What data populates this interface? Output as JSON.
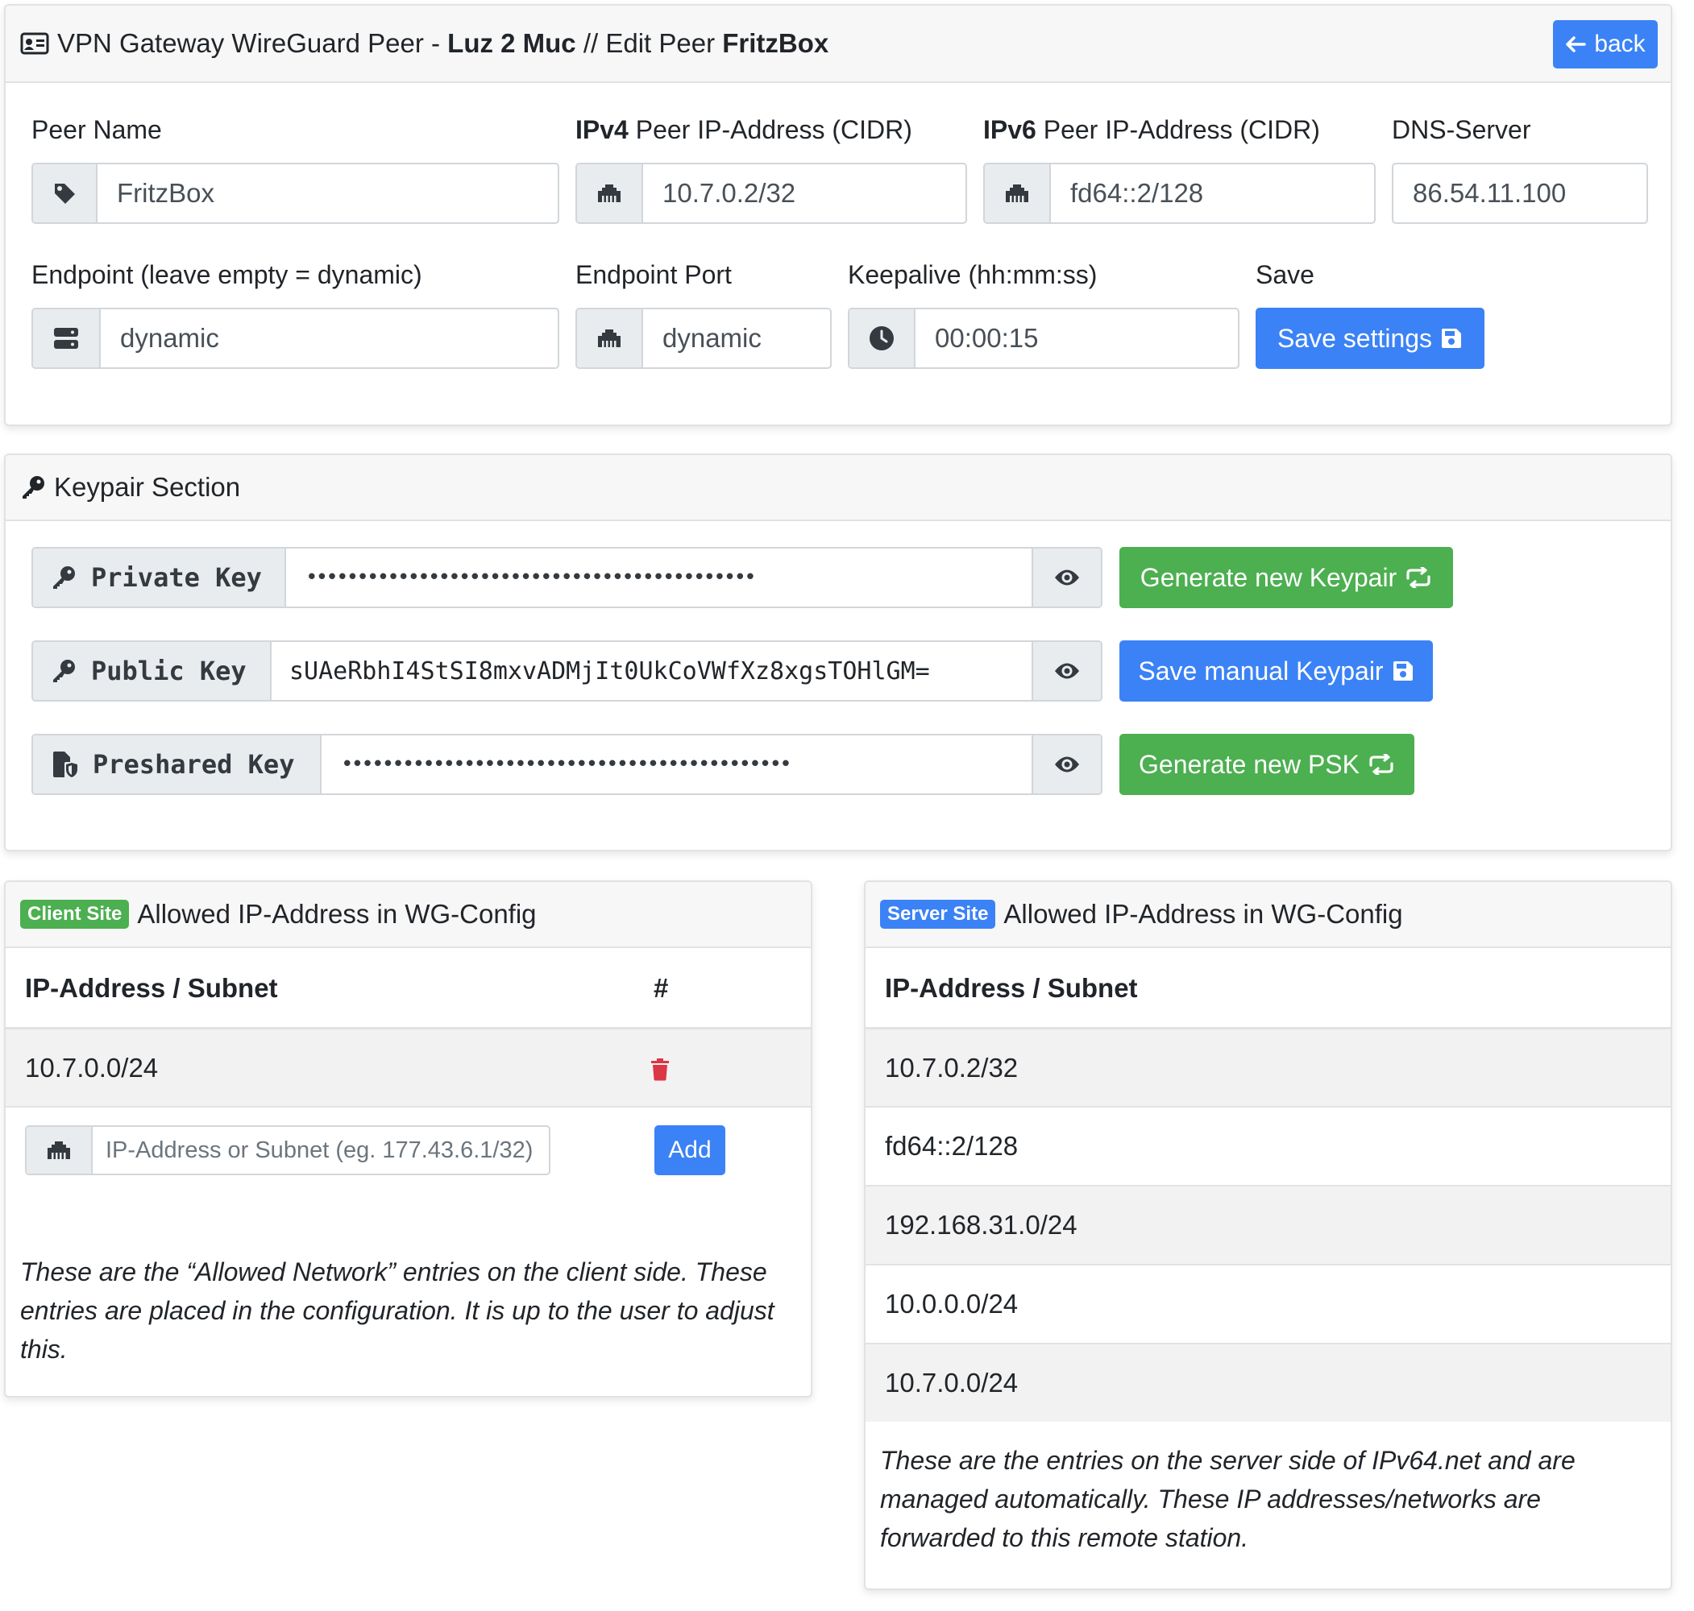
{
  "header": {
    "title_prefix": "VPN Gateway WireGuard Peer - ",
    "gateway_name": "Luz 2 Muc",
    "title_mid": " // Edit Peer ",
    "peer_name": "FritzBox",
    "back_label": "back"
  },
  "settings": {
    "peer_name_label": "Peer Name",
    "peer_name_value": "FritzBox",
    "ipv4_bold": "IPv4",
    "ipv4_label": " Peer IP-Address (CIDR)",
    "ipv4_value": "10.7.0.2/32",
    "ipv6_bold": "IPv6",
    "ipv6_label": " Peer IP-Address (CIDR)",
    "ipv6_value": "fd64::2/128",
    "dns_label": "DNS-Server",
    "dns_value": "86.54.11.100",
    "endpoint_label": "Endpoint (leave empty = dynamic)",
    "endpoint_value": "dynamic",
    "endpoint_port_label": "Endpoint Port",
    "endpoint_port_value": "dynamic",
    "keepalive_label": "Keepalive (hh:mm:ss)",
    "keepalive_value": "00:00:15",
    "save_label": "Save",
    "save_button": "Save settings"
  },
  "keypair": {
    "title": "Keypair Section",
    "private_label": "Private Key",
    "private_value": "••••••••••••••••••••••••••••••••••••••••••••",
    "public_label": "Public Key",
    "public_value": "sUAeRbhI4StSI8mxvADMjIt0UkCoVWfXz8xgsTOHlGM=",
    "psk_label": "Preshared Key",
    "psk_value": "••••••••••••••••••••••••••••••••••••••••••••",
    "generate_keypair_button": "Generate new Keypair",
    "save_keypair_button": "Save manual Keypair",
    "generate_psk_button": "Generate new PSK"
  },
  "client_site": {
    "badge": "Client Site",
    "title": "Allowed IP-Address in WG-Config",
    "col_address": "IP-Address / Subnet",
    "col_action": "#",
    "rows": [
      "10.7.0.0/24"
    ],
    "input_placeholder": "IP-Address or Subnet (eg. 177.43.6.1/32)",
    "add_button": "Add",
    "note": "These are the “Allowed Network” entries on the client side. These entries are placed in the configuration. It is up to the user to adjust this."
  },
  "server_site": {
    "badge": "Server Site",
    "title": "Allowed IP-Address in WG-Config",
    "col_address": "IP-Address / Subnet",
    "rows": [
      "10.7.0.2/32",
      "fd64::2/128",
      "192.168.31.0/24",
      "10.0.0.0/24",
      "10.7.0.0/24"
    ],
    "note": "These are the entries on the server side of IPv64.net and are managed automatically. These IP addresses/networks are forwarded to this remote station."
  },
  "colors": {
    "primary": "#3b82f6",
    "success": "#4caf50",
    "danger": "#dc3545"
  }
}
